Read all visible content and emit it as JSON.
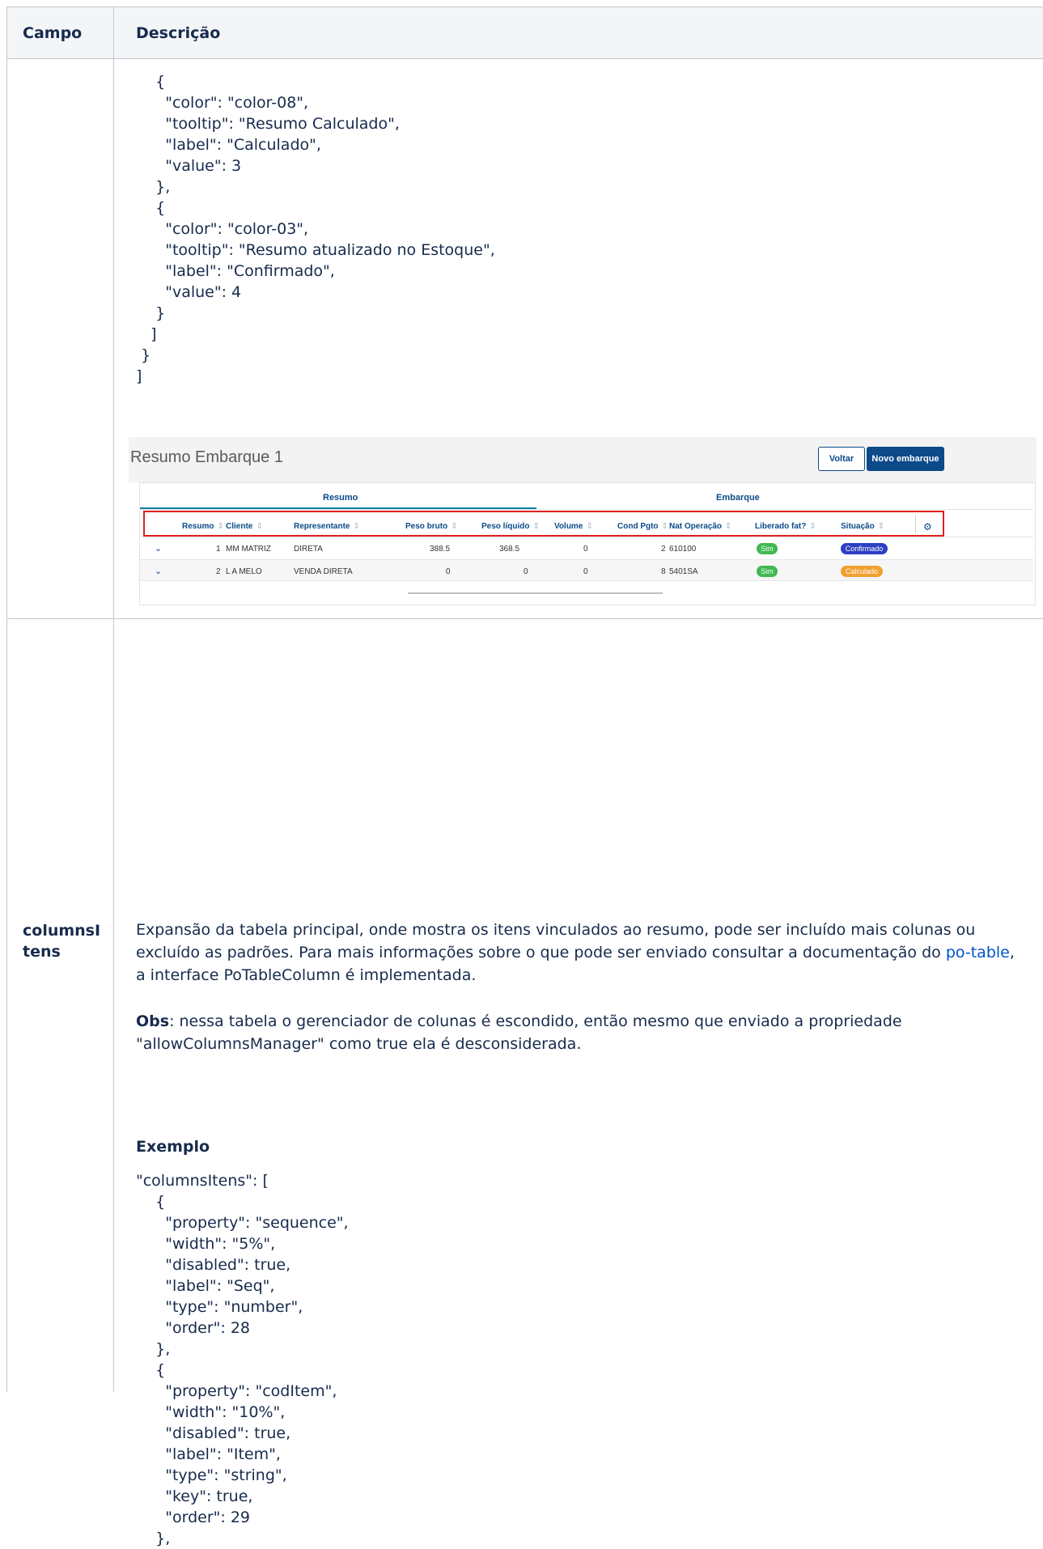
{
  "table": {
    "headers": {
      "campo": "Campo",
      "descricao": "Descrição"
    }
  },
  "code_top": [
    "    {",
    "      \"color\": \"color-08\",",
    "      \"tooltip\": \"Resumo Calculado\",",
    "      \"label\": \"Calculado\",",
    "      \"value\": 3",
    "    },",
    "    {",
    "      \"color\": \"color-03\",",
    "      \"tooltip\": \"Resumo atualizado no Estoque\",",
    "      \"label\": \"Confirmado\",",
    "      \"value\": 4",
    "    }",
    "   ]",
    " }",
    "]"
  ],
  "screenshot": {
    "title": "Resumo Embarque 1",
    "buttons": {
      "voltar": "Voltar",
      "novo": "Novo embarque"
    },
    "tabs": {
      "resumo": "Resumo",
      "embarque": "Embarque"
    },
    "columns": [
      "Resumo",
      "Cliente",
      "Representante",
      "Peso bruto",
      "Peso líquido",
      "Volume",
      "Cond Pgto",
      "Nat Operação",
      "Liberado fat?",
      "Situação"
    ],
    "rows": [
      {
        "resumo": "1",
        "cliente": "MM MATRIZ",
        "representante": "DIRETA",
        "peso_bruto": "388.5",
        "peso_liquido": "368.5",
        "volume": "0",
        "cond_pgto": "2",
        "nat_operacao": "610100",
        "liberado": "Sim",
        "situacao": "Confirmado",
        "situacao_color": "#2e3fc4"
      },
      {
        "resumo": "2",
        "cliente": "L A MELO",
        "representante": "VENDA DIRETA",
        "peso_bruto": "0",
        "peso_liquido": "0",
        "volume": "0",
        "cond_pgto": "8",
        "nat_operacao": "5401SA",
        "liberado": "Sim",
        "situacao": "Calculado",
        "situacao_color": "#f0a030"
      }
    ],
    "icons": {
      "expand": "chevron-down-icon",
      "settings": "gear-icon"
    }
  },
  "row_columnsItens": {
    "label": "columnsI tens",
    "description_part1": "Expansão da tabela principal, onde mostra os itens vinculados ao resumo, pode ser incluído mais colunas ou excluído as padrões. Para mais informações sobre o que pode ser enviado consultar a documentação do ",
    "link_text": "po-table",
    "description_part2": ", a interface PoTableColumn é implementada.",
    "obs_label": "Obs",
    "obs_text": ": nessa tabela o gerenciador de colunas é escondido, então mesmo que enviado a propriedade \"allowColumnsManager\" como true ela é desconsiderada.",
    "example_heading": "Exemplo"
  },
  "code_bottom": [
    "\"columnsItens\": [",
    "    {",
    "      \"property\": \"sequence\",",
    "      \"width\": \"5%\",",
    "      \"disabled\": true,",
    "      \"label\": \"Seq\",",
    "      \"type\": \"number\",",
    "      \"order\": 28",
    "    },",
    "    {",
    "      \"property\": \"codItem\",",
    "      \"width\": \"10%\",",
    "      \"disabled\": true,",
    "      \"label\": \"Item\",",
    "      \"type\": \"string\",",
    "      \"key\": true,",
    "      \"order\": 29",
    "    },"
  ]
}
